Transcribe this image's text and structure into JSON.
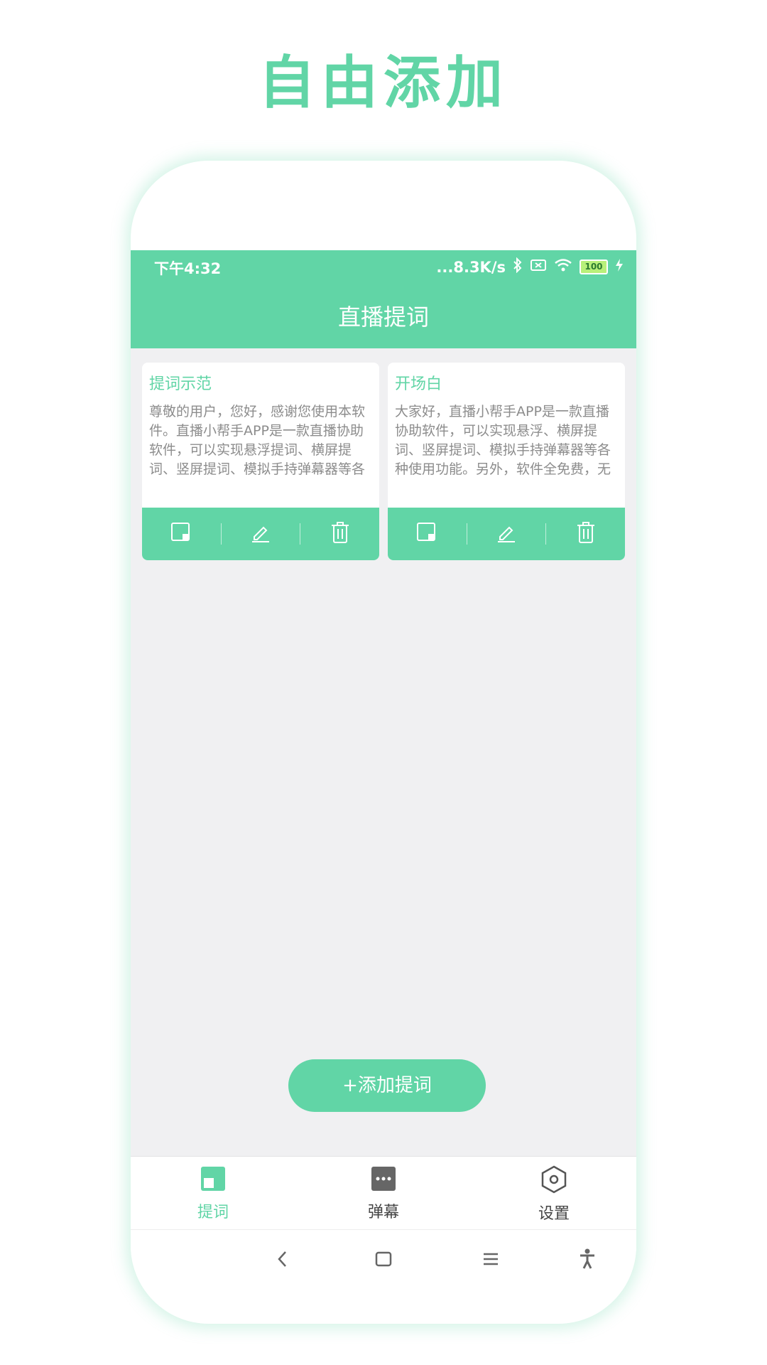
{
  "promo": {
    "title": "自由添加"
  },
  "status_bar": {
    "time": "下午4:32",
    "network_speed": "...8.3K/s",
    "battery": "100",
    "icons": [
      "bluetooth-icon",
      "sim-off-icon",
      "wifi-icon",
      "battery-icon",
      "charging-icon"
    ]
  },
  "app_bar": {
    "title": "直播提词"
  },
  "cards": [
    {
      "title": "提词示范",
      "body": "尊敬的用户，您好，感谢您使用本软件。直播小帮手APP是一款直播协助软件，可以实现悬浮提词、横屏提词、竖屏提词、模拟手持弹幕器等各"
    },
    {
      "title": "开场白",
      "body": "大家好，直播小帮手APP是一款直播协助软件，可以实现悬浮、横屏提词、竖屏提词、模拟手持弹幕器等各种使用功能。另外，软件全免费，无"
    }
  ],
  "card_actions": [
    "float-icon",
    "edit-icon",
    "delete-icon"
  ],
  "add_button": {
    "label": "+添加提词"
  },
  "tabs": [
    {
      "label": "提词",
      "icon": "prompt-icon",
      "active": true
    },
    {
      "label": "弹幕",
      "icon": "danmaku-icon",
      "active": false
    },
    {
      "label": "设置",
      "icon": "settings-icon",
      "active": false
    }
  ],
  "colors": {
    "accent": "#61d5a6",
    "background": "#f0f0f2",
    "text_muted": "#8c8c8c",
    "inactive_icon": "#666666"
  }
}
